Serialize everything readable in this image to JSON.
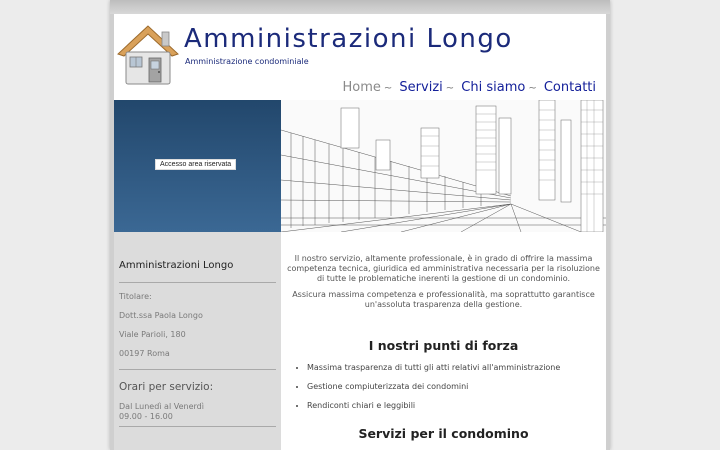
{
  "header": {
    "title": "Amministrazioni Longo",
    "subtitle": "Amministrazione condominiale",
    "logo_icon": "house-icon"
  },
  "nav": {
    "items": [
      {
        "label": "Home"
      },
      {
        "label": "Servizi"
      },
      {
        "label": "Chi siamo"
      },
      {
        "label": "Contatti"
      }
    ],
    "separator": "~"
  },
  "hero": {
    "login_label": "Accesso area riservata"
  },
  "sidebar": {
    "title": "Amministrazioni Longo",
    "owner_label": "Titolare:",
    "owner_name": "Dott.ssa Paola Longo",
    "address": "Viale Parioli, 180",
    "city": "00197 Roma",
    "hours_title": "Orari per servizio:",
    "hours_days": "Dal Lunedì al Venerdì",
    "hours_time": "09.00 - 16.00"
  },
  "main": {
    "intro": "Il nostro servizio, altamente professionale, è in grado di offrire la massima competenza tecnica, giuridica ed amministrativa necessaria per la risoluzione di tutte le problematiche inerenti la gestione di un condominio.",
    "intro2": "Assicura massima competenza e professionalità, ma soprattutto garantisce un'assoluta trasparenza della gestione.",
    "strengths_title": "I nostri punti di forza",
    "strengths": [
      "Massima trasparenza di tutti gli atti relativi all'amministrazione",
      "Gestione compiuterizzata dei condomini",
      "Rendiconti chiari e leggibili"
    ],
    "services_title": "Servizi per il condomino"
  },
  "colors": {
    "title": "#1b2a7a",
    "nav": "#14209a",
    "hero_blue": "#2c5780",
    "sidebar_bg": "#dcdcdc"
  }
}
